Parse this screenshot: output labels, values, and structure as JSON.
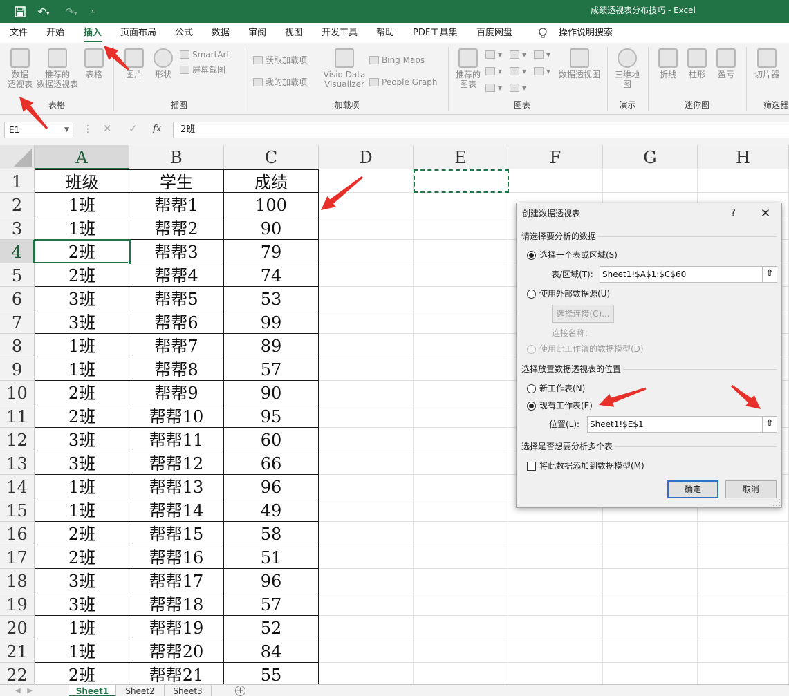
{
  "window": {
    "title": "成绩透视表分布技巧 - Excel"
  },
  "quick_access": {
    "save_icon": "save-icon",
    "undo_icon": "undo-icon",
    "redo_icon": "redo-icon",
    "customize_icon": "customize-icon"
  },
  "tabs": [
    "文件",
    "开始",
    "插入",
    "页面布局",
    "公式",
    "数据",
    "审阅",
    "视图",
    "开发工具",
    "帮助",
    "PDF工具集",
    "百度网盘"
  ],
  "active_tab": "插入",
  "tell_me": "操作说明搜索",
  "ribbon": {
    "groups": [
      "表格",
      "插图",
      "加载项",
      "图表",
      "演示",
      "迷你图",
      "筛选器"
    ],
    "pivot_table": "数据\n透视表",
    "recommended_pivot": "推荐的\n数据透视表",
    "table": "表格",
    "picture": "图片",
    "shapes": "形状",
    "smartart": "SmartArt",
    "screenshot": "屏幕截图",
    "get_addins": "获取加载项",
    "my_addins": "我的加载项",
    "visio": "Visio Data\nVisualizer",
    "bing_maps": "Bing Maps",
    "people_graph": "People Graph",
    "recommended_charts": "推荐的\n图表",
    "pivot_chart": "数据透视图",
    "map3d": "三维地\n图",
    "line": "折线",
    "column": "柱形",
    "winloss": "盈亏",
    "slicer": "切片器"
  },
  "formula_bar": {
    "name_box": "E1",
    "cancel": "✕",
    "enter": "✓",
    "fx": "fx",
    "formula": "2班"
  },
  "columns": [
    "A",
    "B",
    "C",
    "D",
    "E",
    "F",
    "G",
    "H"
  ],
  "rows": [
    "1",
    "2",
    "3",
    "4",
    "5",
    "6",
    "7",
    "8",
    "9",
    "10",
    "11",
    "12",
    "13",
    "14",
    "15",
    "16",
    "17",
    "18",
    "19",
    "20",
    "21",
    "22"
  ],
  "table": {
    "header": [
      "班级",
      "学生",
      "成绩"
    ],
    "data": [
      [
        "1班",
        "帮帮1",
        "100"
      ],
      [
        "1班",
        "帮帮2",
        "90"
      ],
      [
        "2班",
        "帮帮3",
        "79"
      ],
      [
        "2班",
        "帮帮4",
        "74"
      ],
      [
        "3班",
        "帮帮5",
        "53"
      ],
      [
        "3班",
        "帮帮6",
        "99"
      ],
      [
        "1班",
        "帮帮7",
        "89"
      ],
      [
        "1班",
        "帮帮8",
        "57"
      ],
      [
        "2班",
        "帮帮9",
        "90"
      ],
      [
        "2班",
        "帮帮10",
        "95"
      ],
      [
        "3班",
        "帮帮11",
        "60"
      ],
      [
        "3班",
        "帮帮12",
        "66"
      ],
      [
        "1班",
        "帮帮13",
        "96"
      ],
      [
        "1班",
        "帮帮14",
        "49"
      ],
      [
        "2班",
        "帮帮15",
        "58"
      ],
      [
        "2班",
        "帮帮16",
        "51"
      ],
      [
        "3班",
        "帮帮17",
        "96"
      ],
      [
        "3班",
        "帮帮18",
        "57"
      ],
      [
        "1班",
        "帮帮19",
        "52"
      ],
      [
        "1班",
        "帮帮20",
        "84"
      ],
      [
        "2班",
        "帮帮21",
        "55"
      ]
    ]
  },
  "sheets": [
    "Sheet1",
    "Sheet2",
    "Sheet3"
  ],
  "dialog": {
    "title": "创建数据透视表",
    "help": "?",
    "close": "✕",
    "section_data": "请选择要分析的数据",
    "opt_range": "选择一个表或区域(S)",
    "range_label": "表/区域(T):",
    "range_value": "Sheet1!$A$1:$C$60",
    "opt_external": "使用外部数据源(U)",
    "choose_conn": "选择连接(C)...",
    "conn_name": "连接名称:",
    "opt_model": "使用此工作簿的数据模型(D)",
    "section_location": "选择放置数据透视表的位置",
    "opt_new_sheet": "新工作表(N)",
    "opt_existing": "现有工作表(E)",
    "location_label": "位置(L):",
    "location_value": "Sheet1!$E$1",
    "section_multi": "选择是否想要分析多个表",
    "add_to_model": "将此数据添加到数据模型(M)",
    "ok": "确定",
    "cancel": "取消"
  },
  "colors": {
    "excel_green": "#217346",
    "annotation_red": "#e8302a"
  }
}
